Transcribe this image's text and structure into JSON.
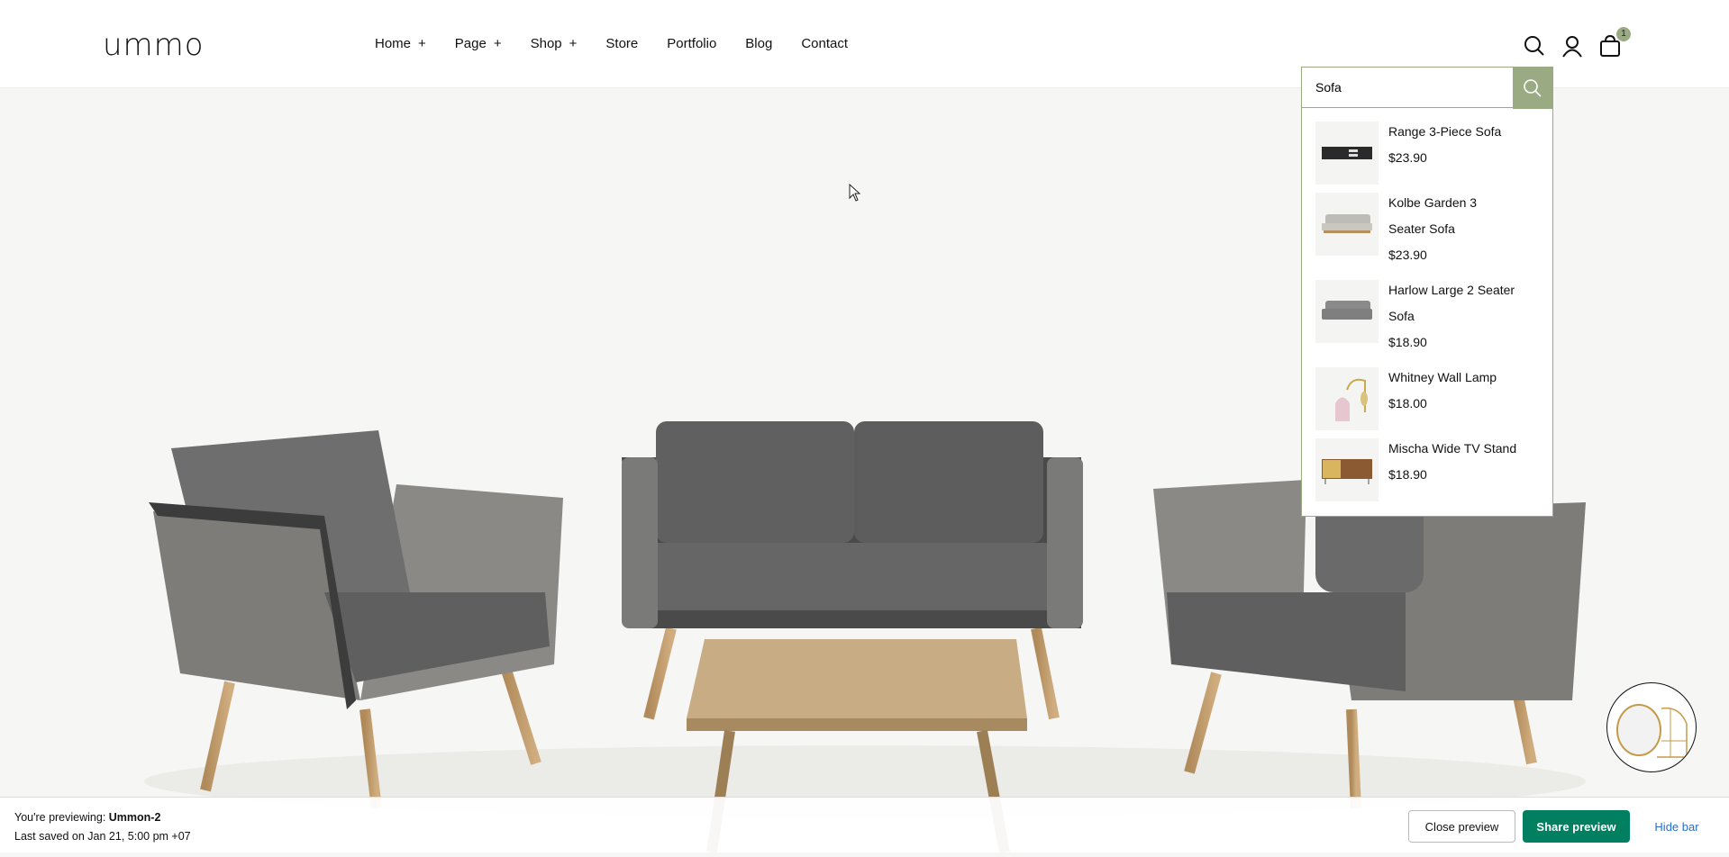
{
  "header": {
    "logo": "ummo",
    "nav": [
      {
        "label": "Home",
        "plus": "+"
      },
      {
        "label": "Page",
        "plus": "+"
      },
      {
        "label": "Shop",
        "plus": "+"
      },
      {
        "label": "Store"
      },
      {
        "label": "Portfolio"
      },
      {
        "label": "Blog"
      },
      {
        "label": "Contact"
      }
    ],
    "cart_count": "1",
    "icons": [
      "search-icon",
      "user-icon",
      "cart-icon"
    ]
  },
  "search": {
    "value": "Sofa",
    "results": [
      {
        "name": "Range 3-Piece Sofa",
        "price": "$23.90"
      },
      {
        "name": "Kolbe Garden 3 Seater Sofa",
        "price": "$23.90"
      },
      {
        "name": "Harlow Large 2 Seater Sofa",
        "price": "$18.90"
      },
      {
        "name": "Whitney Wall Lamp",
        "price": "$18.00"
      },
      {
        "name": "Mischa Wide TV Stand",
        "price": "$18.90"
      }
    ]
  },
  "preview_bar": {
    "prefix": "You're previewing: ",
    "theme": "Ummon-2",
    "saved": "Last saved on Jan 21, 5:00 pm +07",
    "close": "Close preview",
    "share": "Share preview",
    "hide": "Hide bar"
  },
  "colors": {
    "accent": "#9aab84",
    "share": "#008060",
    "link": "#2c6ecb",
    "hero_bg": "#f6f6f4"
  }
}
